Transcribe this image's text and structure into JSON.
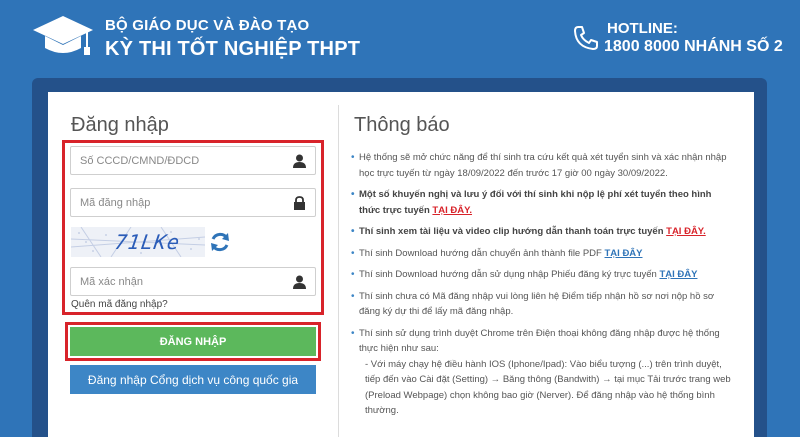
{
  "header": {
    "org": "BỘ GIÁO DỤC VÀ ĐÀO TẠO",
    "exam": "KỲ THI TỐT NGHIỆP THPT",
    "hotline_label": "HOTLINE:",
    "hotline_number": "1800 8000 NHÁNH SỐ 2"
  },
  "login": {
    "title": "Đăng nhập",
    "id_placeholder": "Số CCCD/CMND/ĐDCD",
    "code_placeholder": "Mã đăng nhập",
    "captcha_text": "71LKe",
    "verify_placeholder": "Mã xác nhận",
    "forgot": "Quên mã đăng nhập?",
    "login_button": "ĐĂNG NHẬP",
    "portal_button": "Đăng nhập Cổng dịch vụ công quốc gia"
  },
  "notices": {
    "title": "Thông báo",
    "items": [
      {
        "text": "Hệ thống sẽ mở chức năng để thí sinh tra cứu kết quả xét tuyển sinh và xác nhận nhập học trực tuyến từ ngày 18/09/2022 đến trước 17 giờ 00 ngày 30/09/2022.",
        "link": ""
      },
      {
        "text": "Một số khuyến nghị và lưu ý đối với thí sinh khi nộp lệ phí xét tuyển theo hình thức trực tuyến",
        "link": "TẠI ĐÂY."
      },
      {
        "text": "Thí sinh xem tài liệu và video clip hướng dẫn thanh toán trực tuyến",
        "link": "TẠI ĐÂY."
      },
      {
        "text": "Thí sinh Download hướng dẫn chuyển ảnh thành file PDF",
        "link": "TẠI ĐÂY"
      },
      {
        "text": "Thí sinh Download hướng dẫn sử dụng nhập Phiếu đăng ký trực tuyến",
        "link": "TẠI ĐÂY"
      },
      {
        "text": "Thí sinh chưa có Mã đăng nhập vui lòng liên hệ Điểm tiếp nhận hồ sơ nơi nộp hồ sơ đăng ký dự thi để lấy mã đăng nhập.",
        "link": ""
      },
      {
        "text": "Thí sinh sử dụng trình duyệt Chrome trên Điện thoại không đăng nhập được hệ thống thực hiện như sau:",
        "sub": "- Với máy chạy hệ điều hành IOS (Iphone/Ipad): Vào biểu tượng (...) trên trình duyệt, tiếp đến vào Cài đặt (Setting) → Băng thông (Bandwith) → tại mục Tải trước trang web (Preload Webpage) chọn không bao giờ (Nerver). Để đăng nhập vào hệ thống bình thường.",
        "link": ""
      }
    ]
  },
  "colors": {
    "background": "#2f74b8",
    "frame": "#24518a",
    "highlight": "#d8232a",
    "login_button": "#5cb85c",
    "portal_button": "#3d86c6"
  },
  "icons": {
    "logo": "graduation-cap-icon",
    "phone": "phone-icon",
    "user": "user-icon",
    "lock": "lock-icon",
    "refresh": "refresh-icon"
  }
}
